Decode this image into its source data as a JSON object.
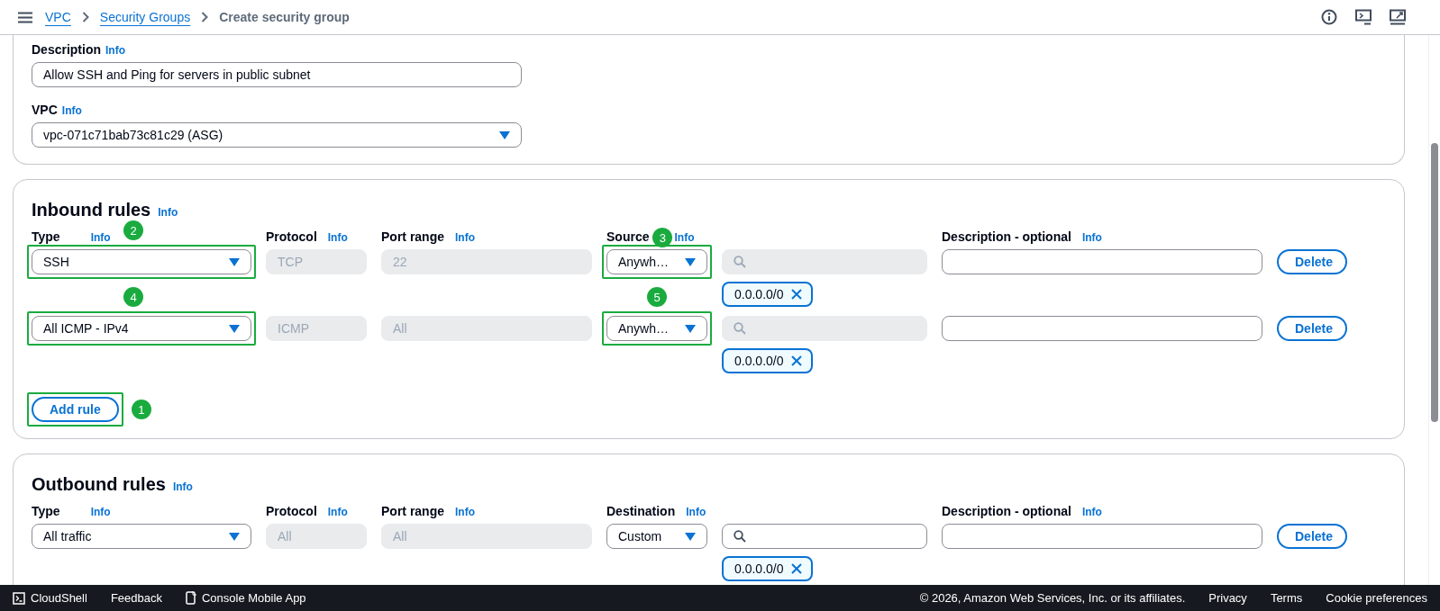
{
  "breadcrumbs": [
    {
      "label": "VPC",
      "kind": "link"
    },
    {
      "label": "Security Groups",
      "kind": "link"
    },
    {
      "label": "Create security group",
      "kind": "current"
    }
  ],
  "details": {
    "description_label": "Description",
    "description_info": "Info",
    "description_value": "Allow SSH and Ping for servers in public subnet",
    "vpc_label": "VPC",
    "vpc_info": "Info",
    "vpc_value": "vpc-071c71bab73c81c29 (ASG)"
  },
  "inbound": {
    "title": "Inbound rules",
    "info": "Info",
    "columns": [
      {
        "label": "Type",
        "info": "Info"
      },
      {
        "label": "Protocol",
        "info": "Info"
      },
      {
        "label": "Port range",
        "info": "Info"
      },
      {
        "label": "Source",
        "info": "Info",
        "marker": "3"
      },
      {
        "label": "Description - optional",
        "info": "Info"
      }
    ],
    "rules": [
      {
        "type": "SSH",
        "type_highlight": true,
        "type_marker": "2",
        "protocol": "TCP",
        "port_range": "22",
        "source": "Anywh…",
        "source_highlight": true,
        "search_disabled": true,
        "chip": "0.0.0.0/0",
        "delete": "Delete"
      },
      {
        "type": "All ICMP - IPv4",
        "type_highlight": true,
        "type_marker": "4",
        "protocol": "ICMP",
        "port_range": "All",
        "source": "Anywh…",
        "source_highlight": true,
        "source_marker": "5",
        "search_disabled": true,
        "chip": "0.0.0.0/0",
        "delete": "Delete"
      }
    ],
    "add_rule": {
      "label": "Add rule",
      "highlight": true,
      "marker": "1"
    }
  },
  "outbound": {
    "title": "Outbound rules",
    "info": "Info",
    "columns": [
      {
        "label": "Type",
        "info": "Info"
      },
      {
        "label": "Protocol",
        "info": "Info"
      },
      {
        "label": "Port range",
        "info": "Info"
      },
      {
        "label": "Destination",
        "info": "Info"
      },
      {
        "label": "Description - optional",
        "info": "Info"
      }
    ],
    "rules": [
      {
        "type": "All traffic",
        "type_highlight": false,
        "protocol": "All",
        "port_range": "All",
        "source": "Custom",
        "source_highlight": false,
        "search_disabled": false,
        "chip": "0.0.0.0/0",
        "delete": "Delete"
      }
    ]
  },
  "footer": {
    "left": [
      {
        "label": "CloudShell",
        "kind": "cloudshell"
      },
      {
        "label": "Feedback",
        "kind": "plain"
      },
      {
        "label": "Console Mobile App",
        "kind": "mobile"
      }
    ],
    "copyright": "© 2026, Amazon Web Services, Inc. or its affiliates.",
    "links": [
      "Privacy",
      "Terms",
      "Cookie preferences"
    ]
  }
}
